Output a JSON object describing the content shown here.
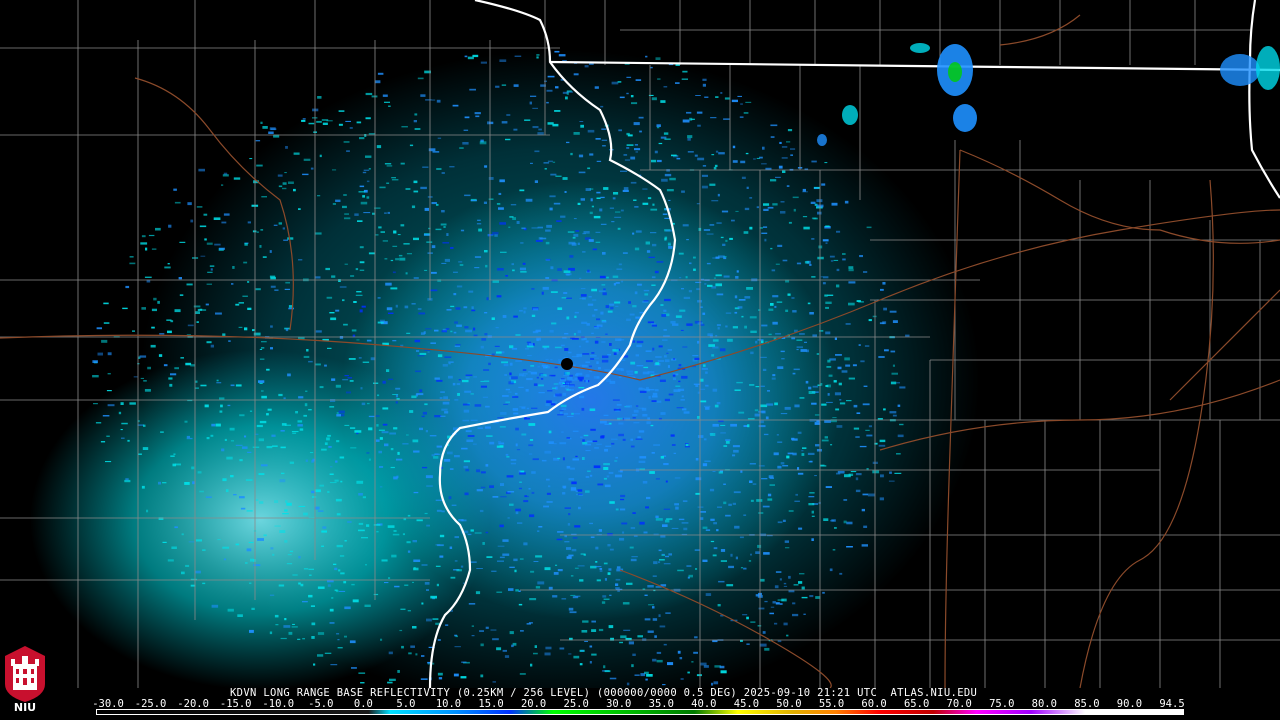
{
  "caption": "KDVN LONG RANGE BASE REFLECTIVITY (0.25KM / 256 LEVEL) (000000/0000 0.5 DEG) 2025-09-10 21:21 UTC  ATLAS.NIU.EDU",
  "logo_text": "NIU",
  "scale": {
    "ticks": [
      "-30.0",
      "-25.0",
      "-20.0",
      "-15.0",
      "-10.0",
      "-5.0",
      "0.0",
      "5.0",
      "10.0",
      "15.0",
      "20.0",
      "25.0",
      "30.0",
      "35.0",
      "40.0",
      "45.0",
      "50.0",
      "55.0",
      "60.0",
      "65.0",
      "70.0",
      "75.0",
      "80.0",
      "85.0",
      "90.0",
      "94.5"
    ]
  },
  "colors": {
    "background": "#000000",
    "state_border": "#ffffff",
    "county_line": "#8a8a8a",
    "highway": "#8b4a2a",
    "echo_light": "#00e0e8",
    "echo_mid": "#1e90ff",
    "echo_strong": "#0030ff",
    "logo_red": "#c8102e"
  }
}
